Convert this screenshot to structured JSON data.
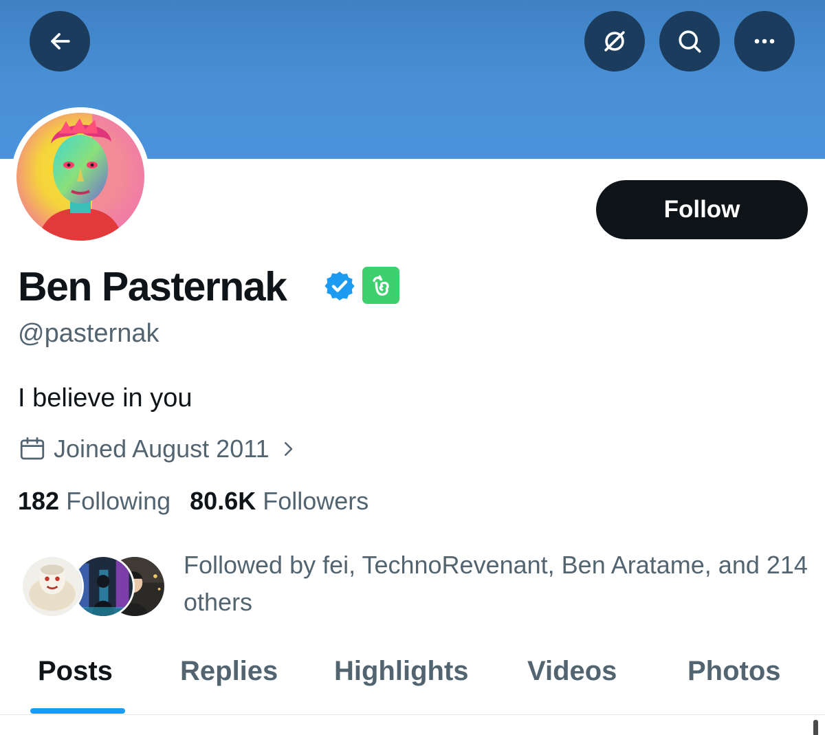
{
  "header": {
    "back_icon": "arrow-left-icon",
    "actions": [
      "grok-icon",
      "search-icon",
      "more-icon"
    ]
  },
  "colors": {
    "banner": "#4a90d6",
    "accent": "#1d9bf0",
    "button_dark": "#0f1419",
    "secondary_text": "#536471",
    "badge_green": "#3ecf6e"
  },
  "profile": {
    "name": "Ben Pasternak",
    "handle": "@pasternak",
    "bio": "I believe in you",
    "joined": "Joined August 2011",
    "verified_icon": "verified-badge-icon",
    "affiliate_icon": "affiliate-badge-icon"
  },
  "follow_button": {
    "label": "Follow"
  },
  "stats": {
    "following_count": "182",
    "following_label": "Following",
    "followers_count": "80.6K",
    "followers_label": "Followers"
  },
  "mutuals": {
    "text": "Followed by fei, TechnoRevenant, Ben Aratame, and 214 others"
  },
  "tabs": [
    {
      "label": "Posts",
      "active": true
    },
    {
      "label": "Replies",
      "active": false
    },
    {
      "label": "Highlights",
      "active": false
    },
    {
      "label": "Videos",
      "active": false
    },
    {
      "label": "Photos",
      "active": false
    }
  ]
}
